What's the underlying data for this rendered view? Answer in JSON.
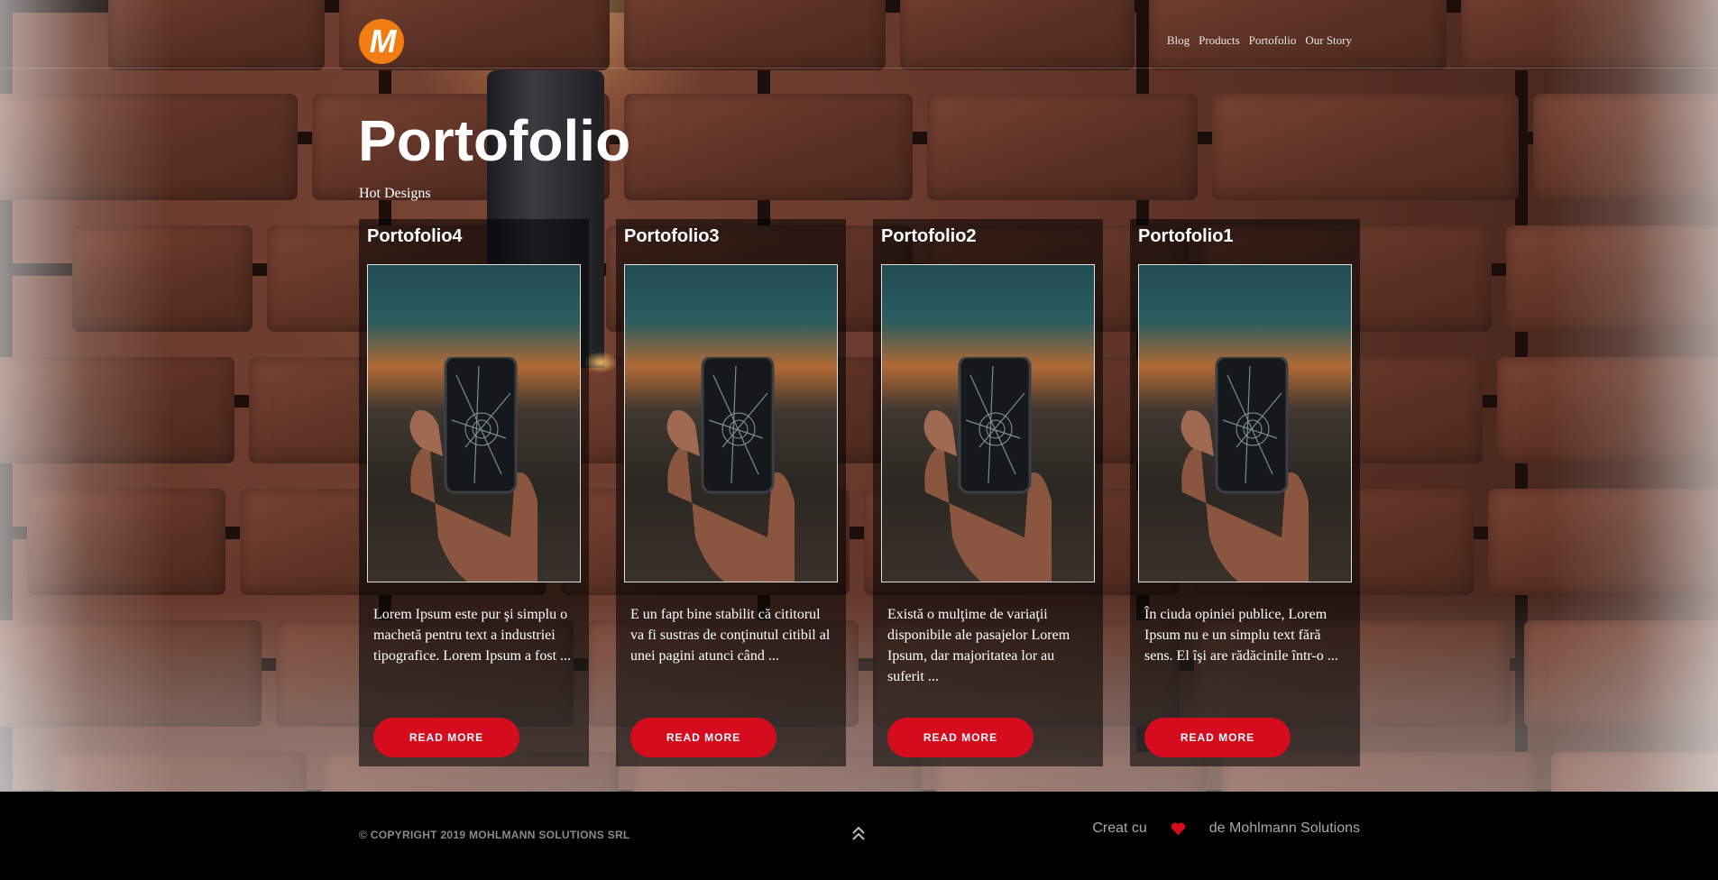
{
  "header": {
    "logo_icon": "mohlmann-m-logo",
    "nav": [
      "Blog",
      "Products",
      "Portofolio",
      "Our Story"
    ]
  },
  "hero": {
    "title": "Portofolio",
    "subtitle": "Hot Designs"
  },
  "cards": [
    {
      "title": "Portofolio4",
      "text": "Lorem Ipsum este pur şi simplu o machetă pentru text a industriei tipografice. Lorem Ipsum a fost ...",
      "button": "READ MORE",
      "image_icon": "cracked-phone-photo"
    },
    {
      "title": "Portofolio3",
      "text": "E un fapt bine stabilit că cititorul va fi sustras de conţinutul citibil al unei pagini atunci când ...",
      "button": "READ MORE",
      "image_icon": "cracked-phone-photo"
    },
    {
      "title": "Portofolio2",
      "text": "Există o mulţime de variaţii disponibile ale pasajelor Lorem Ipsum, dar majoritatea lor au suferit ...",
      "button": "READ MORE",
      "image_icon": "cracked-phone-photo"
    },
    {
      "title": "Portofolio1",
      "text": "În ciuda opiniei publice, Lorem Ipsum nu e un simplu text fără sens. El îşi are rădăcinile într-o ...",
      "button": "READ MORE",
      "image_icon": "cracked-phone-photo"
    }
  ],
  "footer": {
    "copyright": "© COPYRIGHT 2019 MOHLMANN SOLUTIONS SRL",
    "to_top_icon": "double-chevron-up-icon",
    "credit_prefix": "Creat cu",
    "credit_icon": "heart-icon",
    "credit_suffix": "de Mohlmann Solutions"
  },
  "colors": {
    "accent": "#d50b1e",
    "logo": "#f27d12",
    "footer_bg": "#000000"
  }
}
